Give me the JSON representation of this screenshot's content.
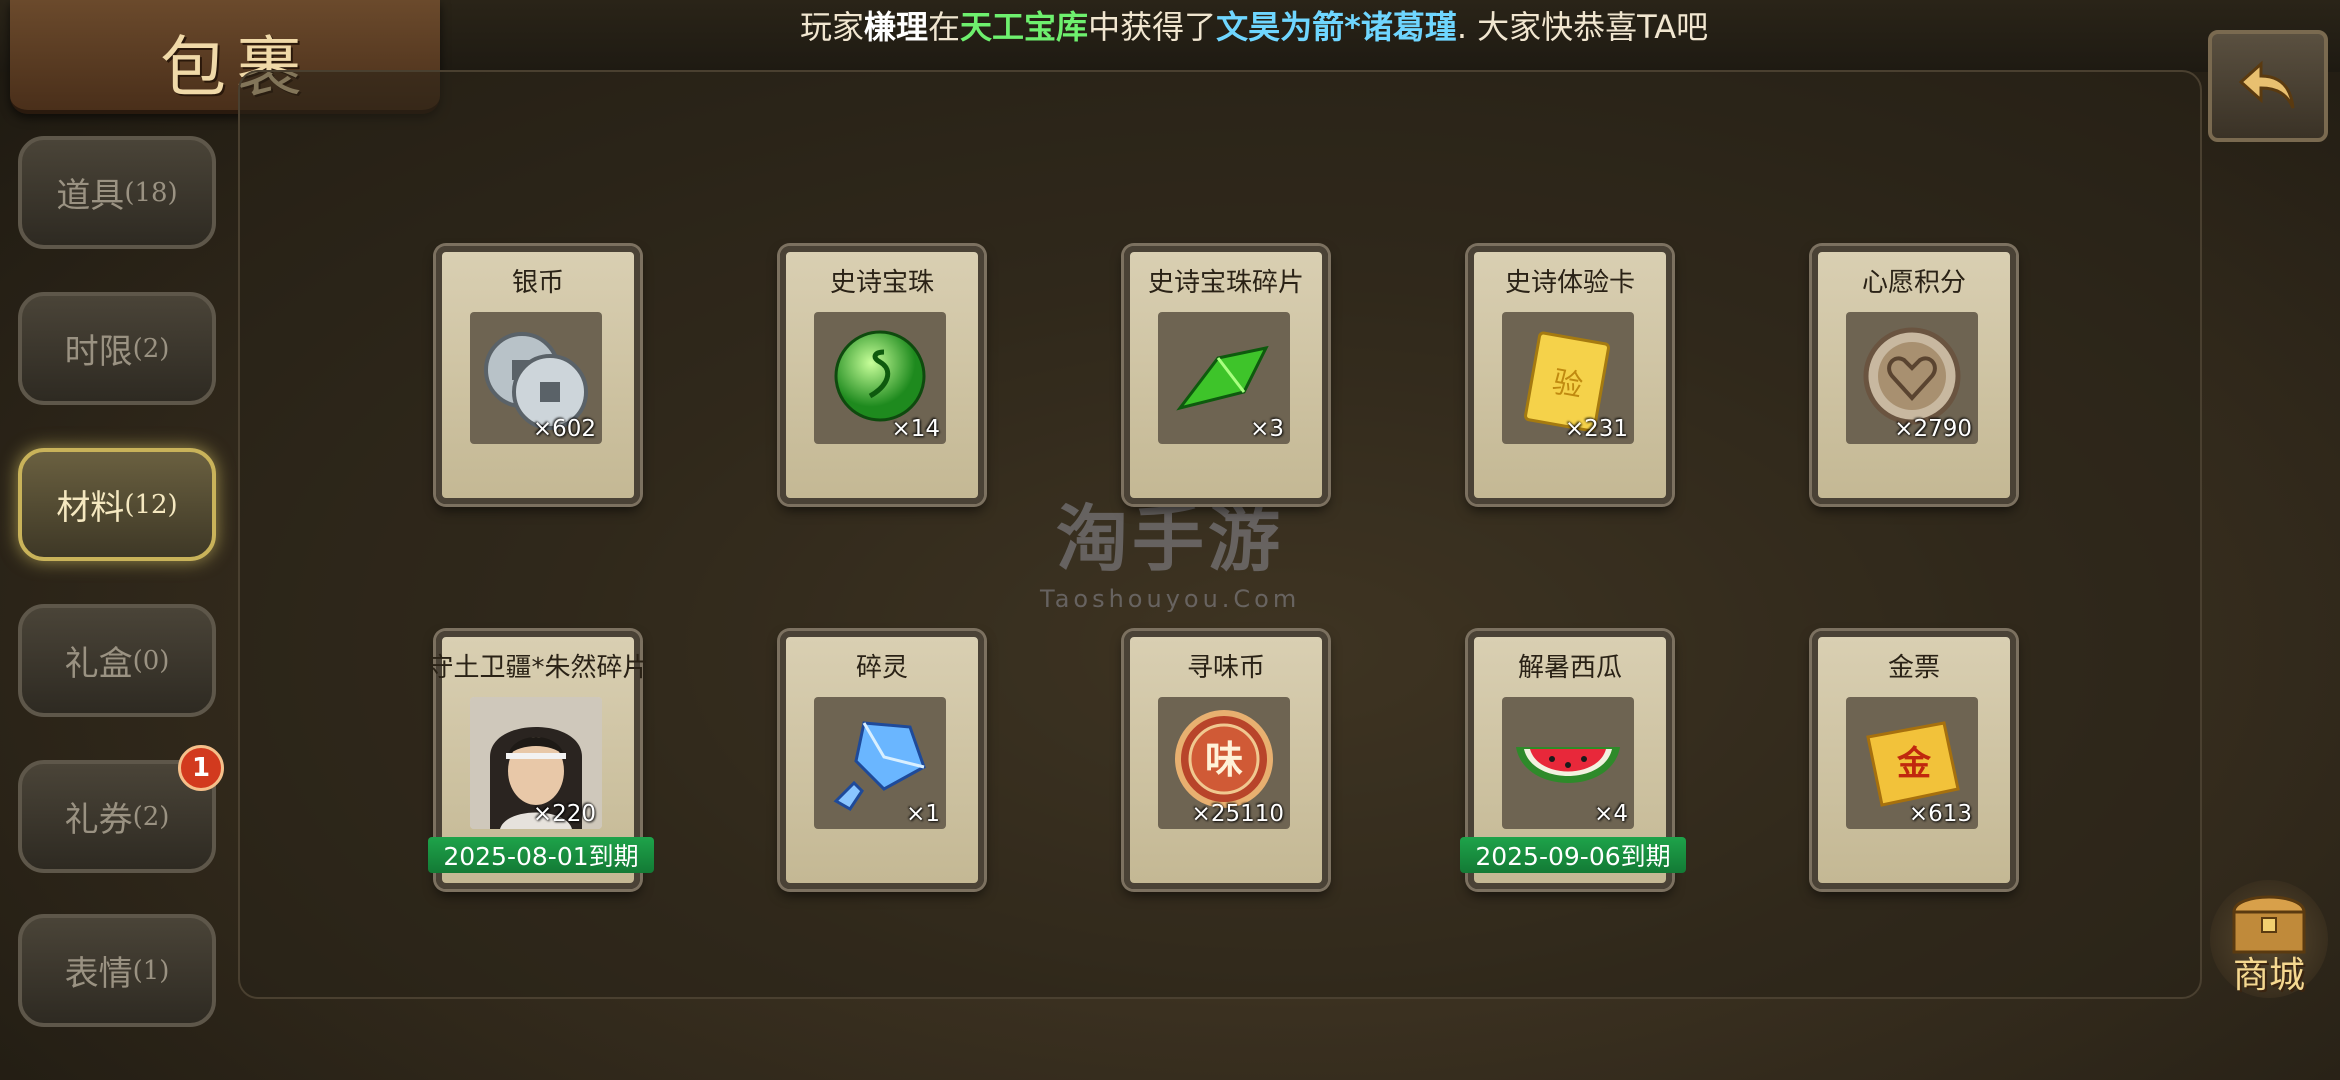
{
  "header": {
    "title": "包裹",
    "announcement": {
      "prefix": "玩家",
      "player": "槏理",
      "mid1": "在",
      "place": "天工宝库",
      "mid2": "中获得了",
      "item": "文昊为箭*诸葛瑾",
      "suffix": ". 大家快恭喜TA吧"
    }
  },
  "sidebar": {
    "tabs": [
      {
        "label": "道具",
        "count": "(18)"
      },
      {
        "label": "时限",
        "count": "(2)"
      },
      {
        "label": "材料",
        "count": "(12)",
        "active": true
      },
      {
        "label": "礼盒",
        "count": "(0)"
      },
      {
        "label": "礼券",
        "count": "(2)",
        "badge": "1"
      },
      {
        "label": "表情",
        "count": "(1)"
      }
    ]
  },
  "items": [
    {
      "name": "银币",
      "qty": "×602",
      "icon": "silver-coin-icon"
    },
    {
      "name": "史诗宝珠",
      "qty": "×14",
      "icon": "green-orb-icon"
    },
    {
      "name": "史诗宝珠碎片",
      "qty": "×3",
      "icon": "green-shard-icon"
    },
    {
      "name": "史诗体验卡",
      "qty": "×231",
      "icon": "gold-card-icon"
    },
    {
      "name": "心愿积分",
      "qty": "×2790",
      "icon": "heart-coin-icon"
    },
    {
      "name": "守土卫疆*朱然碎片",
      "qty": "×220",
      "icon": "hero-portrait-icon",
      "expire": "2025-08-01到期"
    },
    {
      "name": "碎灵",
      "qty": "×1",
      "icon": "blue-crystal-icon"
    },
    {
      "name": "寻味币",
      "qty": "×25110",
      "icon": "taste-coin-icon"
    },
    {
      "name": "解暑西瓜",
      "qty": "×4",
      "icon": "watermelon-icon",
      "expire": "2025-09-06到期"
    },
    {
      "name": "金票",
      "qty": "×613",
      "icon": "gold-ticket-icon"
    }
  ],
  "icon_glyphs": {
    "taste": "味",
    "ticket": "金",
    "card": "验"
  },
  "watermark": {
    "big": "淘手游",
    "small": "Taoshouyou.Com"
  },
  "shop": {
    "label": "商城"
  }
}
